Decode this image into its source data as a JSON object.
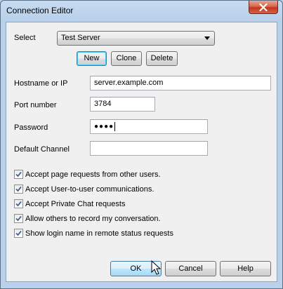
{
  "window": {
    "title": "Connection Editor",
    "close_icon": "close-icon"
  },
  "select_row": {
    "label": "Select",
    "selected": "Test Server"
  },
  "actions": {
    "new_label": "New",
    "clone_label": "Clone",
    "delete_label": "Delete"
  },
  "fields": {
    "hostname_label": "Hostname or IP",
    "hostname_value": "server.example.com",
    "port_label": "Port number",
    "port_value": "3784",
    "password_label": "Password",
    "password_value": "●●●●",
    "channel_label": "Default Channel",
    "channel_value": ""
  },
  "options": [
    {
      "label": "Accept page requests from other users.",
      "checked": true
    },
    {
      "label": "Accept User-to-user communications.",
      "checked": true
    },
    {
      "label": "Accept Private Chat requests",
      "checked": true
    },
    {
      "label": "Allow others to record my conversation.",
      "checked": true
    },
    {
      "label": "Show login name in remote status requests",
      "checked": true
    }
  ],
  "footer": {
    "ok_label": "OK",
    "cancel_label": "Cancel",
    "help_label": "Help"
  },
  "colors": {
    "accent_border": "#3c7fb1",
    "check_color": "#4a5f97"
  }
}
